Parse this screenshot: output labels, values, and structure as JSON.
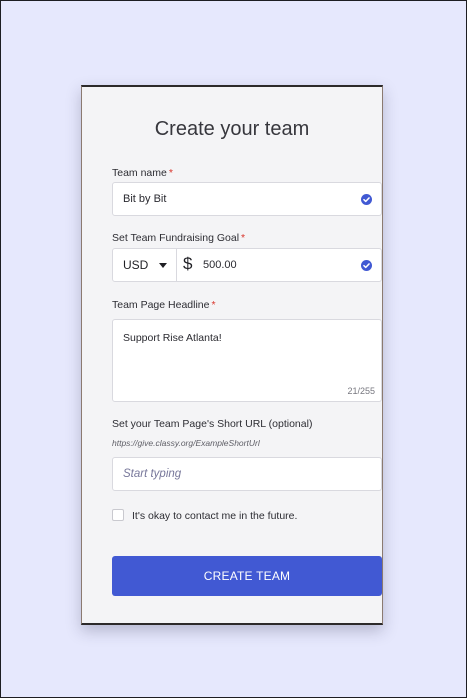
{
  "form": {
    "title": "Create your team",
    "required_marker": "*",
    "team_name": {
      "label": "Team name",
      "value": "Bit by Bit"
    },
    "goal": {
      "label": "Set Team Fundraising Goal",
      "currency": "USD",
      "currency_symbol": "$",
      "value": "500.00"
    },
    "headline": {
      "label": "Team Page Headline",
      "value": "Support Rise Atlanta!",
      "counter": "21/255"
    },
    "short_url": {
      "label": "Set your Team Page's Short URL (optional)",
      "hint": "https://give.classy.org/ExampleShortUrl",
      "placeholder": "Start typing"
    },
    "contact_checkbox": {
      "label": "It's okay to contact me in the future."
    },
    "submit_label": "CREATE TEAM"
  },
  "icons": {
    "valid": "check-circle-icon",
    "currency_dropdown": "caret-down-icon"
  },
  "colors": {
    "page_background": "#e6e8fd",
    "card_background": "#f4f4f6",
    "accent": "#4159d3",
    "required": "#d9342b"
  }
}
